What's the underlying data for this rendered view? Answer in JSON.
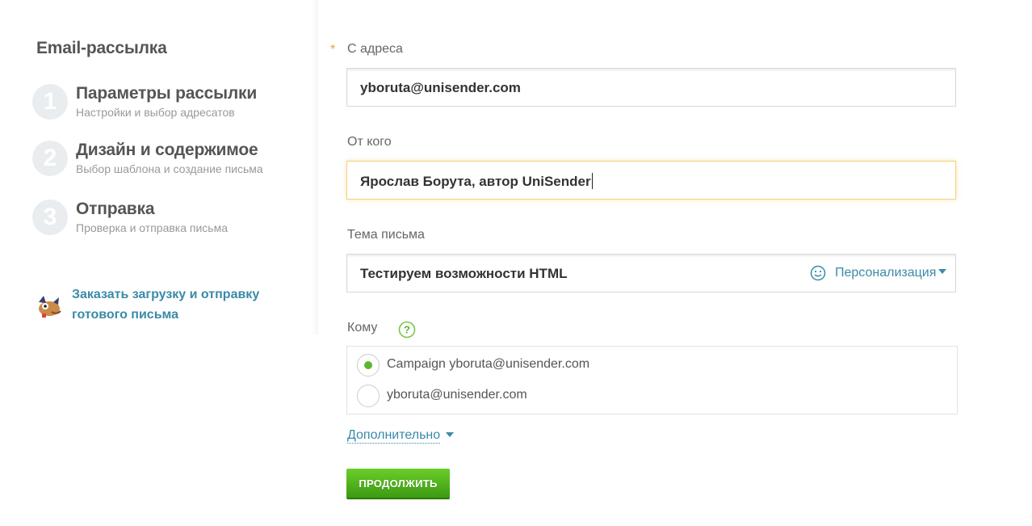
{
  "sidebar": {
    "title": "Email-рассылка",
    "steps": [
      {
        "num": "1",
        "title": "Параметры рассылки",
        "subtitle": "Настройки и выбор адресатов"
      },
      {
        "num": "2",
        "title": "Дизайн и содержимое",
        "subtitle": "Выбор шаблона и создание письма"
      },
      {
        "num": "3",
        "title": "Отправка",
        "subtitle": "Проверка и отправка письма"
      }
    ],
    "order_link": {
      "line1": "Заказать загрузку и отправку",
      "line2": "готового письма",
      "icon": "mascot-icon"
    }
  },
  "form": {
    "from_address": {
      "label": "С адреса",
      "required_mark": "*",
      "value": "yboruta@unisender.com"
    },
    "from_name": {
      "label": "От кого",
      "value": "Ярослав Борута, автор UniSender"
    },
    "subject": {
      "label": "Тема письма",
      "value": "Тестируем возможности HTML",
      "personalization": "Персонализация"
    },
    "recipients": {
      "label": "Кому",
      "options": [
        {
          "label": "Campaign yboruta@unisender.com",
          "selected": true
        },
        {
          "label": "yboruta@unisender.com",
          "selected": false
        }
      ]
    },
    "more_label": "Дополнительно",
    "continue_label": "ПРОДОЛЖИТЬ"
  },
  "colors": {
    "accent_link": "#3a8aa8",
    "button_green": "#4caf1c",
    "required_orange": "#f0a030"
  }
}
